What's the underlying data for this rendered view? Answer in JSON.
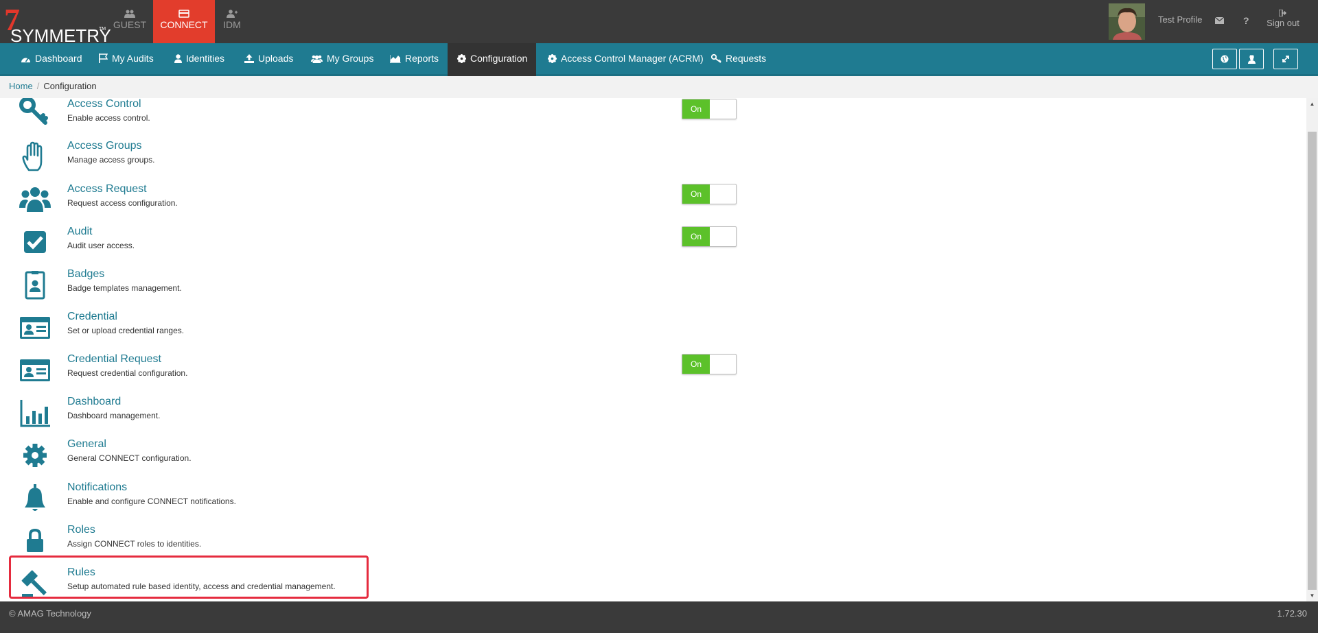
{
  "logo": {
    "text": "SYMMETRY",
    "tm": "TM"
  },
  "apps": [
    {
      "label": "GUEST"
    },
    {
      "label": "CONNECT"
    },
    {
      "label": "IDM"
    }
  ],
  "header": {
    "profile_name": "Test Profile",
    "signout_label": "Sign out",
    "help_label": "?"
  },
  "nav": {
    "items": [
      {
        "label": "Dashboard"
      },
      {
        "label": "My Audits"
      },
      {
        "label": "Identities"
      },
      {
        "label": "Uploads"
      },
      {
        "label": "My Groups"
      },
      {
        "label": "Reports"
      },
      {
        "label": "Configuration"
      },
      {
        "label": "Access Control Manager (ACRM)"
      },
      {
        "label": "Requests"
      }
    ]
  },
  "breadcrumb": {
    "home": "Home",
    "current": "Configuration",
    "separator": "/"
  },
  "items": [
    {
      "title": "Access Control",
      "desc": "Enable access control.",
      "toggle": "On",
      "icon": "key-icon"
    },
    {
      "title": "Access Groups",
      "desc": "Manage access groups.",
      "icon": "hand-icon"
    },
    {
      "title": "Access Request",
      "desc": "Request access configuration.",
      "toggle": "On",
      "icon": "users-icon"
    },
    {
      "title": "Audit",
      "desc": "Audit user access.",
      "toggle": "On",
      "icon": "checkbox-icon"
    },
    {
      "title": "Badges",
      "desc": "Badge templates management.",
      "icon": "badge-icon"
    },
    {
      "title": "Credential",
      "desc": "Set or upload credential ranges.",
      "icon": "id-card-icon"
    },
    {
      "title": "Credential Request",
      "desc": "Request credential configuration.",
      "toggle": "On",
      "icon": "id-card-icon"
    },
    {
      "title": "Dashboard",
      "desc": "Dashboard management.",
      "icon": "bar-chart-icon"
    },
    {
      "title": "General",
      "desc": "General CONNECT configuration.",
      "icon": "gear-icon"
    },
    {
      "title": "Notifications",
      "desc": "Enable and configure CONNECT notifications.",
      "icon": "bell-icon"
    },
    {
      "title": "Roles",
      "desc": "Assign CONNECT roles to identities.",
      "icon": "lock-icon"
    },
    {
      "title": "Rules",
      "desc": "Setup automated rule based identity, access and credential management.",
      "icon": "gavel-icon"
    }
  ],
  "footer": {
    "copyright": "© AMAG Technology",
    "version": "1.72.30"
  },
  "colors": {
    "accent": "#1f7b91",
    "brand_red": "#e23d2c",
    "toggle_on": "#5cc12a",
    "highlight": "#e52b3e"
  }
}
